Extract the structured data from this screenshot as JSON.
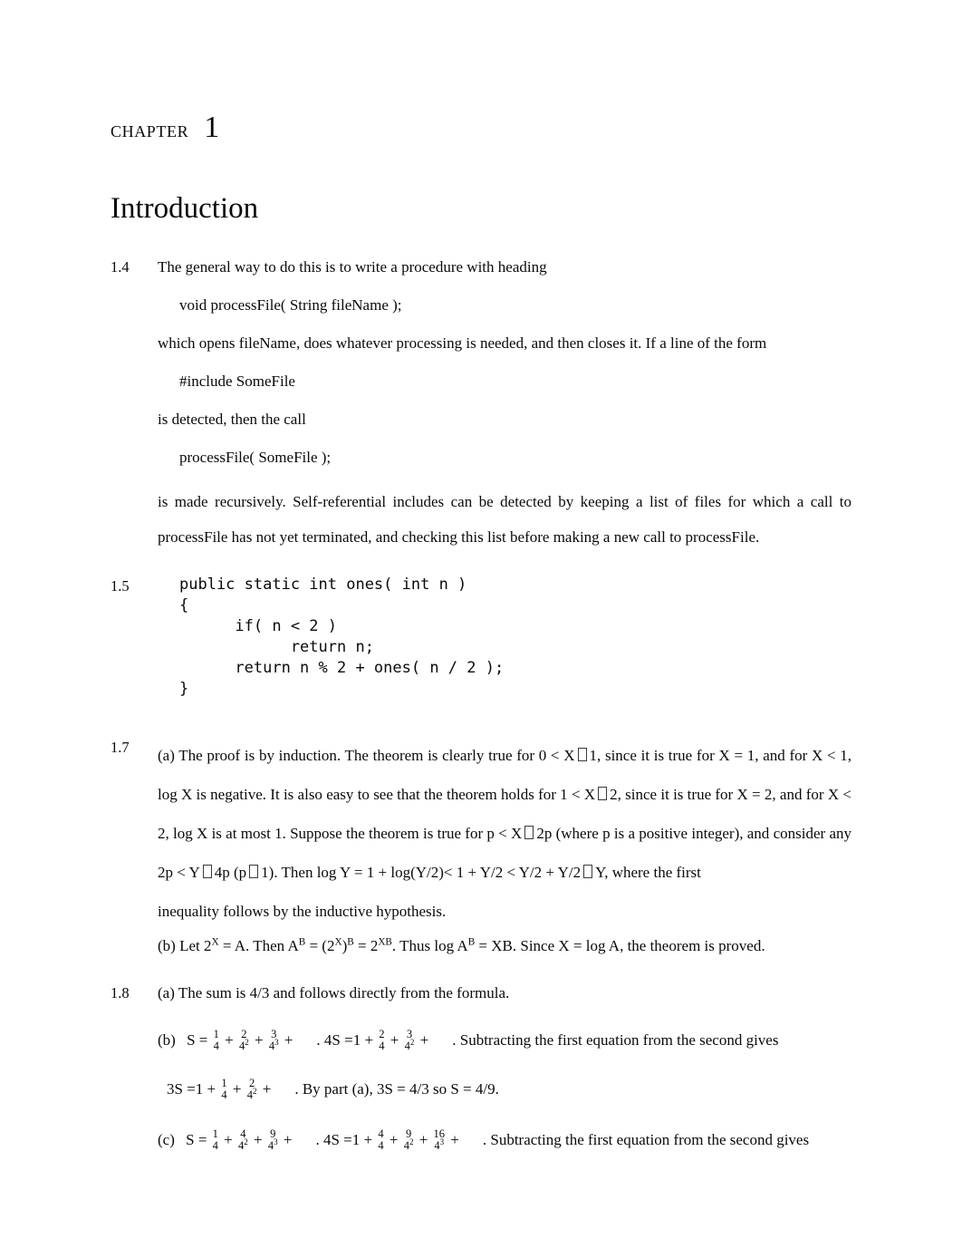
{
  "heading": {
    "chapter_word": "CHAPTER",
    "chapter_number": "1",
    "title": "Introduction"
  },
  "problems": {
    "p14": {
      "number": "1.4",
      "line1": "The general way to do this is to write a procedure with heading",
      "code1": "void processFile( String fileName );",
      "line2": "which opens fileName, does whatever processing is needed, and then closes it. If a line of the form",
      "code2": "#include SomeFile",
      "line3": "is detected, then the call",
      "code3": "processFile( SomeFile );",
      "line4": "is made recursively. Self-referential includes can be detected by keeping a list of files for which a call to processFile has not yet terminated, and checking this list before making a new call to processFile."
    },
    "p15": {
      "number": "1.5",
      "code": "public static int ones( int n )\n{\n      if( n < 2 )\n            return n;\n      return n % 2 + ones( n / 2 );\n}"
    },
    "p17": {
      "number": "1.7",
      "a_l1_1": "(a) The proof is by induction. The theorem is clearly true for 0 < X",
      "a_l1_2": "1, since it is true for X = 1, and for X <",
      "a_l2_1": "1, log X is negative. It is also easy to see that the theorem holds for 1 < X",
      "a_l2_2": "2, since it is true for X = 2, and",
      "a_l3_1": "for X < 2, log X is at most 1. Suppose the theorem is true for p < X",
      "a_l3_2": "2p (where p is a positive integer), and",
      "a_l4_1": "consider any 2p < Y",
      "a_l4_2": "4p (p",
      "a_l4_3": "1). Then log Y = 1 + log(Y/2)<  1 + Y/2 < Y/2 + Y/2",
      "a_l4_4": "Y, where the first",
      "a_l5": "inequality follows by the inductive hypothesis.",
      "b_pre": "(b) Let 2",
      "b_sup1": "X",
      "b_mid1": " = A. Then  A",
      "b_sup2": "B",
      "b_mid2": " = (2",
      "b_sup3": "X",
      "b_mid3": ")",
      "b_sup4": "B",
      "b_mid4": " =  2",
      "b_sup5": "XB",
      "b_mid5": ". Thus log  A",
      "b_sup6": "B",
      "b_end": " = XB. Since X = log A, the theorem is proved."
    },
    "p18": {
      "number": "1.8",
      "a": "(a) The sum is 4/3 and follows directly from the formula.",
      "b_label": "(b)",
      "b_eq1_lead": "S =",
      "b_eq1_t1_num": "1",
      "b_eq1_t1_den": "4",
      "b_eq1_t2_num": "2",
      "b_eq1_t2_den": "4",
      "b_eq1_t2_den_sup": "2",
      "b_eq1_t3_num": "3",
      "b_eq1_t3_den": "4",
      "b_eq1_t3_den_sup": "3",
      "b_eq2_lead": ". 4S =1 +",
      "b_eq2_t1_num": "2",
      "b_eq2_t1_den": "4",
      "b_eq2_t2_num": "3",
      "b_eq2_t2_den": "4",
      "b_eq2_t2_den_sup": "2",
      "b_tail": ".   Subtracting   the   first   equation   from   the   second   gives",
      "c_eq3_lead": "3S =1 +",
      "c_eq3_t1_num": "1",
      "c_eq3_t1_den": "4",
      "c_eq3_t2_num": "2",
      "c_eq3_t2_den": "4",
      "c_eq3_t2_den_sup": "2",
      "c_eq3_tail": ". By part (a), 3S = 4/3 so S = 4/9.",
      "c_label": "(c)",
      "c_eq1_lead": "S =",
      "c_eq1_t1_num": "1",
      "c_eq1_t1_den": "4",
      "c_eq1_t2_num": "4",
      "c_eq1_t2_den": "4",
      "c_eq1_t2_den_sup": "2",
      "c_eq1_t3_num": "9",
      "c_eq1_t3_den": "4",
      "c_eq1_t3_den_sup": "3",
      "c_eq2_lead": ". 4S =1 +",
      "c_eq2_t1_num": "4",
      "c_eq2_t1_den": "4",
      "c_eq2_t2_num": "9",
      "c_eq2_t2_den": "4",
      "c_eq2_t2_den_sup": "2",
      "c_eq2_t3_num": "16",
      "c_eq2_t3_den": "4",
      "c_eq2_t3_den_sup": "3",
      "c_tail": ".   Subtracting   the   first   equation   from   the   second   gives",
      "plus": "+"
    }
  }
}
